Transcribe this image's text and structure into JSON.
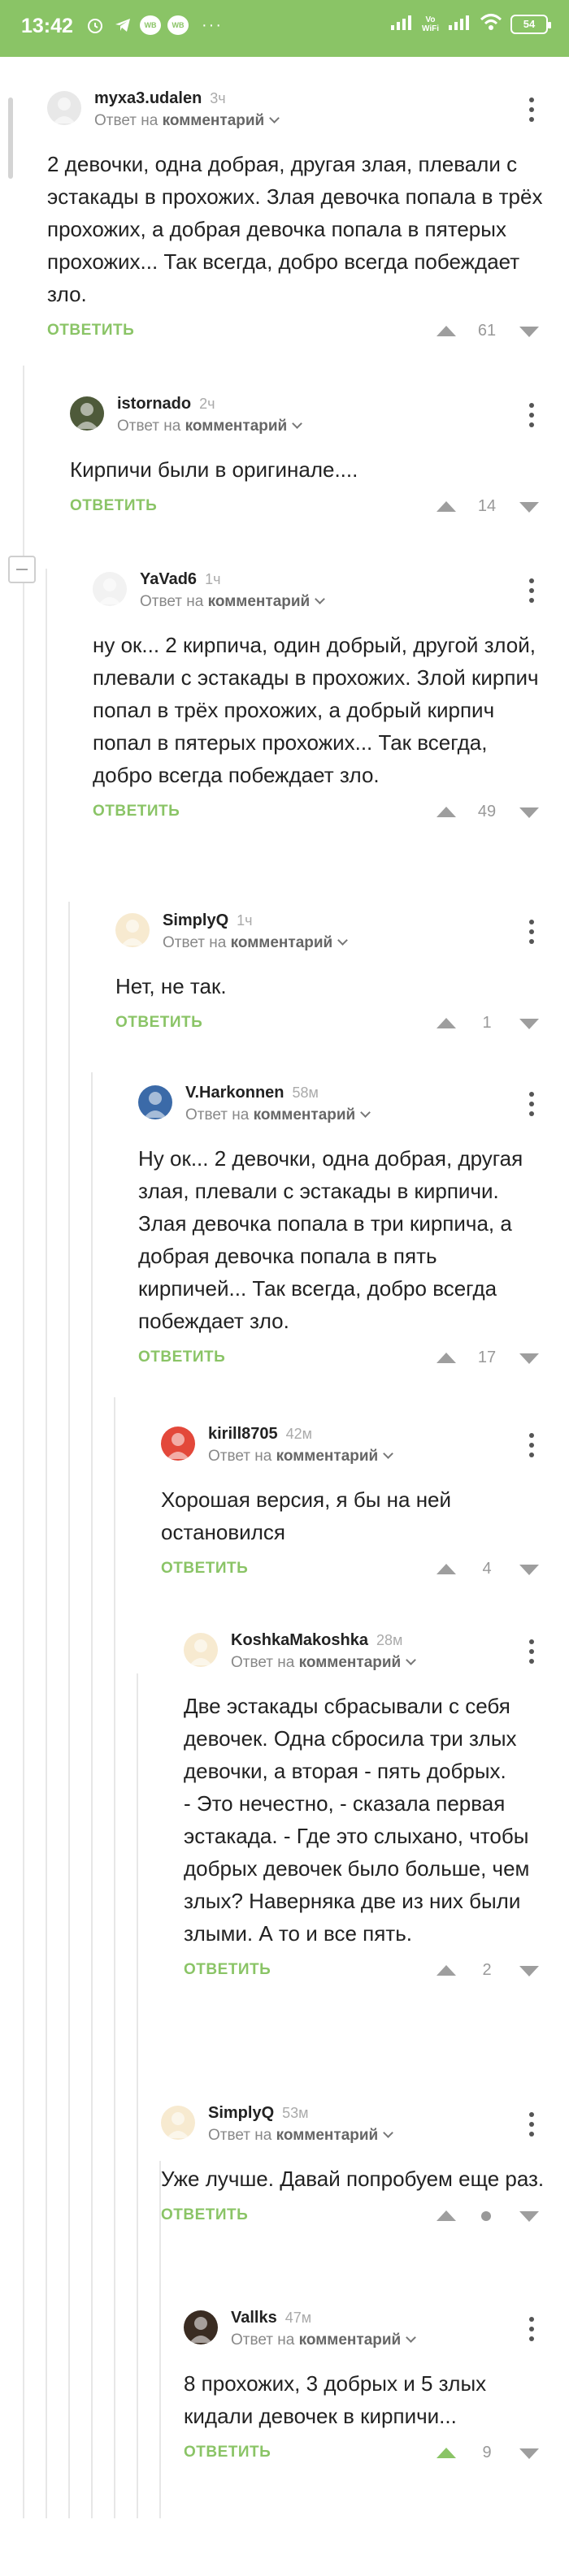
{
  "status_bar": {
    "time": "13:42",
    "badge_1": "WB",
    "badge_2": "WB",
    "dots": "···",
    "network": "Vo\nWiFi",
    "battery": "54"
  },
  "comments": [
    {
      "user": "myxa3.udalen",
      "time": "3ч",
      "reply_prefix": "Ответ на",
      "reply_target": "комментарий",
      "text": "2 девочки, одна добрая, другая злая, плевали с эстакады в прохожих. Злая девочка попала в трёх прохожих, а добрая девочка попала в пятерых прохожих... Так всегда, добро всегда побеждает зло.",
      "answer": "ОТВЕТИТЬ",
      "rating": "61",
      "avatar_color": "#e8e8e8"
    },
    {
      "user": "istornado",
      "time": "2ч",
      "reply_prefix": "Ответ на",
      "reply_target": "комментарий",
      "text": "Кирпичи были в оригинале....",
      "answer": "ОТВЕТИТЬ",
      "rating": "14",
      "avatar_color": "#4e5a3a"
    },
    {
      "user": "YaVad6",
      "time": "1ч",
      "reply_prefix": "Ответ на",
      "reply_target": "комментарий",
      "text": "ну ок... 2 кирпича, один добрый, другой злой, плевали с эстакады в прохожих. Злой кирпич попал в трёх прохожих, а добрый кирпич попал в пятерых прохожих... Так всегда, добро всегда побеждает зло.",
      "answer": "ОТВЕТИТЬ",
      "rating": "49",
      "avatar_color": "#f2f2f2"
    },
    {
      "user": "SimplyQ",
      "time": "1ч",
      "reply_prefix": "Ответ на",
      "reply_target": "комментарий",
      "text": "Нет, не так.",
      "answer": "ОТВЕТИТЬ",
      "rating": "1",
      "avatar_color": "#f7ead0"
    },
    {
      "user": "V.Harkonnen",
      "time": "58м",
      "reply_prefix": "Ответ на",
      "reply_target": "комментарий",
      "text": "Ну ок... 2 девочки, одна добрая, другая злая, плевали с эстакады в кирпичи. Злая девочка попала в три кирпича, а добрая девочка попала в пять кирпичей... Так всегда, добро всегда побеждает зло.",
      "answer": "ОТВЕТИТЬ",
      "rating": "17",
      "avatar_color": "#3b6aa8"
    },
    {
      "user": "kirill8705",
      "time": "42м",
      "reply_prefix": "Ответ на",
      "reply_target": "комментарий",
      "text": "Хорошая версия, я бы на ней остановился",
      "answer": "ОТВЕТИТЬ",
      "rating": "4",
      "avatar_color": "#e3483a"
    },
    {
      "user": "KoshkaMakoshka",
      "time": "28м",
      "reply_prefix": "Ответ на",
      "reply_target": "комментарий",
      "text": "Две эстакады сбрасывали с себя девочек. Одна сбросила три злых девочки, а вторая - пять добрых.\n- Это нечестно, - сказала первая эстакада. - Где это слыхано, чтобы добрых девочек было больше, чем злых? Наверняка две из них были злыми. А то и все пять.",
      "answer": "ОТВЕТИТЬ",
      "rating": "2",
      "avatar_color": "#f7ead0"
    },
    {
      "user": "SimplyQ",
      "time": "53м",
      "reply_prefix": "Ответ на",
      "reply_target": "комментарий",
      "text": "Уже лучше. Давай попробуем еще раз.",
      "answer": "ОТВЕТИТЬ",
      "rating": "•",
      "avatar_color": "#f7ead0"
    },
    {
      "user": "Vallks",
      "time": "47м",
      "reply_prefix": "Ответ на",
      "reply_target": "комментарий",
      "text": "8 прохожих, 3 добрых и 5 злых кидали девочек в кирпичи...",
      "answer": "ОТВЕТИТЬ",
      "rating": "9",
      "avatar_color": "#3a2c22"
    }
  ],
  "colors": {
    "status_bar": "#8ac466",
    "accent": "#8ac466",
    "muted": "#999999"
  }
}
